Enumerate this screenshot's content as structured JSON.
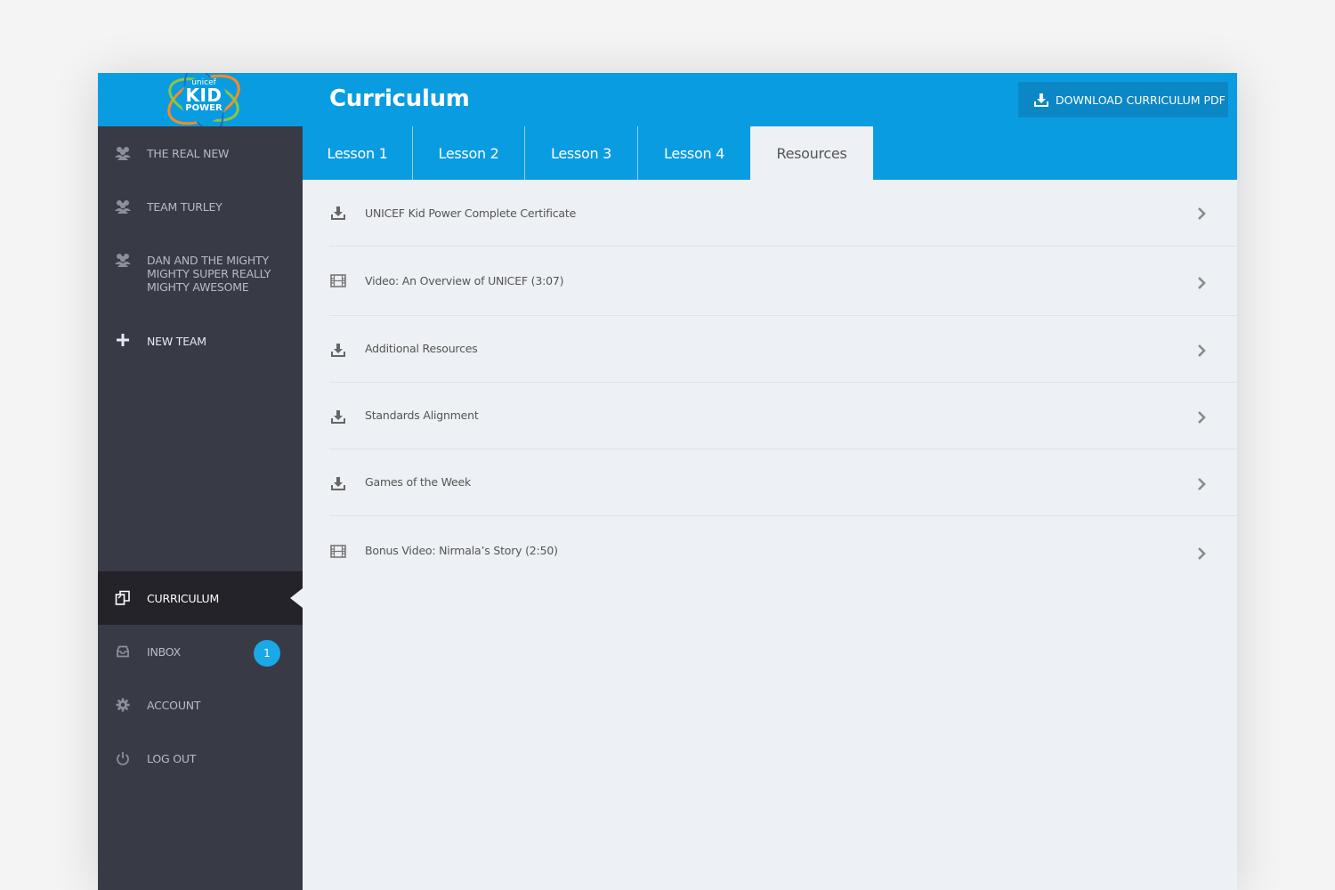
{
  "brand": {
    "logo_line1": "unicef",
    "logo_line2": "KID",
    "logo_line3": "POWER",
    "accent": "#0a9ce0",
    "sidebar_bg": "#383a45"
  },
  "sidebar": {
    "teams": [
      {
        "label": "THE REAL NEW",
        "icon": "users-icon"
      },
      {
        "label": "TEAM TURLEY",
        "icon": "users-icon"
      },
      {
        "label_lines": [
          "DAN AND THE MIGHTY",
          "MIGHTY SUPER REALLY",
          "MIGHTY AWESOME"
        ],
        "icon": "users-icon"
      }
    ],
    "new_team": {
      "label": "NEW TEAM",
      "icon": "plus-icon"
    },
    "bottom": [
      {
        "label": "CURRICULUM",
        "icon": "curriculum-icon",
        "active": true
      },
      {
        "label": "INBOX",
        "icon": "inbox-icon",
        "badge": "1"
      },
      {
        "label": "ACCOUNT",
        "icon": "gear-icon"
      },
      {
        "label": "LOG OUT",
        "icon": "power-icon"
      }
    ]
  },
  "header": {
    "title": "Curriculum",
    "download_label": "DOWNLOAD CURRICULUM PDF"
  },
  "tabs": [
    {
      "label": "Lesson 1"
    },
    {
      "label": "Lesson 2"
    },
    {
      "label": "Lesson 3"
    },
    {
      "label": "Lesson 4"
    },
    {
      "label": "Resources",
      "active": true
    }
  ],
  "resources": [
    {
      "label": "UNICEF Kid Power Complete Certificate",
      "icon": "download-icon"
    },
    {
      "label": "Video: An Overview of UNICEF (3:07)",
      "icon": "film-icon"
    },
    {
      "label": "Additional Resources",
      "icon": "download-icon"
    },
    {
      "label": "Standards Alignment",
      "icon": "download-icon"
    },
    {
      "label": "Games of the Week",
      "icon": "download-icon"
    },
    {
      "label": "Bonus Video: Nirmala’s Story (2:50)",
      "icon": "film-icon"
    }
  ]
}
